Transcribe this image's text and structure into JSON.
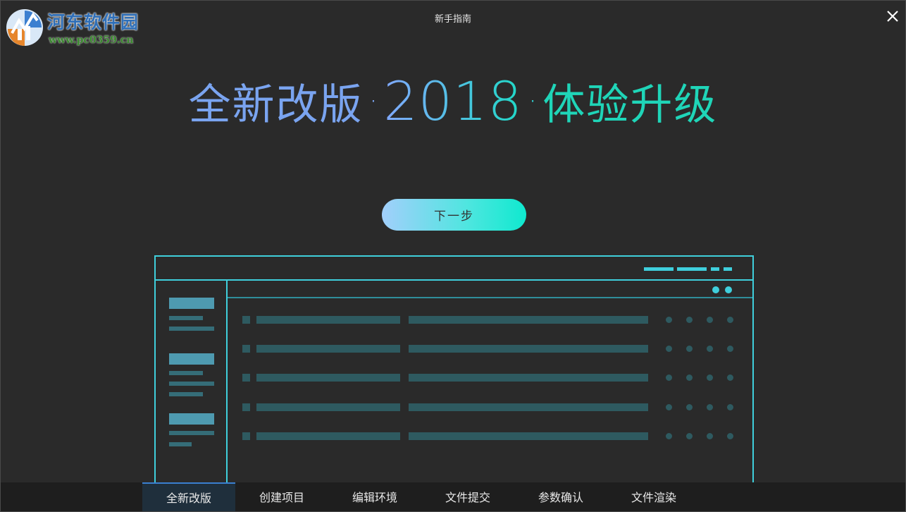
{
  "window": {
    "title": "新手指南",
    "close_icon": "close-icon"
  },
  "watermark": {
    "name": "河东软件园",
    "url": "www.pc0359.cn"
  },
  "headline": {
    "part_a": "全新改版",
    "separator": "·",
    "year": "2018",
    "part_b": "体验升级"
  },
  "next_button": {
    "label": "下一步"
  },
  "tabs": [
    {
      "label": "全新改版",
      "active": true
    },
    {
      "label": "创建项目",
      "active": false
    },
    {
      "label": "编辑环境",
      "active": false
    },
    {
      "label": "文件提交",
      "active": false
    },
    {
      "label": "参数确认",
      "active": false
    },
    {
      "label": "文件渲染",
      "active": false
    }
  ],
  "colors": {
    "background": "#2a2a2a",
    "accent_cyan": "#3fcfdc",
    "button_gradient_start": "#a2cffb",
    "button_gradient_end": "#0fe9cf",
    "tab_active_bg": "#1f2f3c"
  }
}
